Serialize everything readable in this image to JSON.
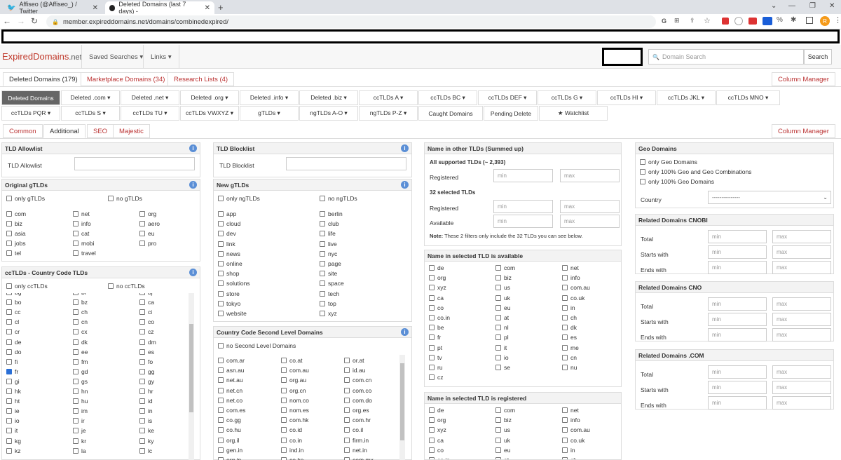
{
  "browser": {
    "tabs": [
      {
        "label": "Affiseo (@Affiseo_) / Twitter"
      },
      {
        "label": "Deleted Domains (last 7 days) -"
      }
    ],
    "new_tab": "+",
    "url": "member.expireddomains.net/domains/combinedexpired/",
    "profile": "R"
  },
  "site": {
    "logo_main": "ExpiredDomains",
    "logo_tld": ".net",
    "nav": [
      "Saved Searches ▾",
      "Links ▾"
    ],
    "search_placeholder": "Domain Search",
    "search_button": "Search"
  },
  "tabs_row1": {
    "items": [
      "Deleted Domains (179)",
      "Marketplace Domains (34)",
      "Research Lists (4)"
    ],
    "column_manager": "Column Manager"
  },
  "nav_row1": [
    "Deleted Domains",
    "Deleted .com ▾",
    "Deleted .net ▾",
    "Deleted .org ▾",
    "Deleted .info ▾",
    "Deleted .biz ▾",
    "ccTLDs A ▾",
    "ccTLDs BC ▾",
    "ccTLDs DEF ▾",
    "ccTLDs G ▾",
    "ccTLDs HI ▾",
    "ccTLDs JKL ▾",
    "ccTLDs MNO ▾"
  ],
  "nav_row2": [
    "ccTLDs PQR ▾",
    "ccTLDs S ▾",
    "ccTLDs TU ▾",
    "ccTLDs VWXYZ ▾",
    "gTLDs ▾",
    "ngTLDs A-O ▾",
    "ngTLDs P-Z ▾",
    "Caught Domains",
    "Pending Delete",
    "★ Watchlist"
  ],
  "filter_tabs": {
    "items": [
      "Common",
      "Additional",
      "SEO",
      "Majestic"
    ],
    "column_manager": "Column Manager"
  },
  "tld_allow": {
    "title": "TLD Allowlist",
    "label": "TLD Allowlist"
  },
  "tld_block": {
    "title": "TLD Blocklist",
    "label": "TLD Blocklist"
  },
  "orig_gtlds": {
    "title": "Original gTLDs",
    "only": "only gTLDs",
    "no": "no gTLDs",
    "items": [
      "com",
      "net",
      "org",
      "biz",
      "info",
      "aero",
      "asia",
      "cat",
      "eu",
      "jobs",
      "mobi",
      "pro",
      "tel",
      "travel"
    ]
  },
  "new_gtlds": {
    "title": "New gTLDs",
    "only": "only ngTLDs",
    "no": "no ngTLDs",
    "items": [
      "app",
      "berlin",
      "cloud",
      "club",
      "dev",
      "life",
      "link",
      "live",
      "news",
      "nyc",
      "online",
      "page",
      "shop",
      "site",
      "solutions",
      "space",
      "store",
      "tech",
      "tokyo",
      "top",
      "website",
      "xyz"
    ]
  },
  "cctlds": {
    "title": "ccTLDs - Country Code TLDs",
    "only": "only ccTLDs",
    "no": "no ccTLDs",
    "items": [
      "bg",
      "bi",
      "bj",
      "bo",
      "bz",
      "ca",
      "cc",
      "ch",
      "ci",
      "cl",
      "cn",
      "co",
      "cr",
      "cx",
      "cz",
      "de",
      "dk",
      "dm",
      "do",
      "ee",
      "es",
      "fi",
      "fm",
      "fo",
      "fr",
      "gd",
      "gg",
      "gi",
      "gs",
      "gy",
      "hk",
      "hn",
      "hr",
      "ht",
      "hu",
      "id",
      "ie",
      "im",
      "in",
      "io",
      "ir",
      "is",
      "it",
      "je",
      "ke",
      "kg",
      "kr",
      "ky",
      "kz",
      "la",
      "lc"
    ]
  },
  "ccsld": {
    "title": "Country Code Second Level Domains",
    "no": "no Second Level Domains",
    "items": [
      "com.ar",
      "co.at",
      "or.at",
      "asn.au",
      "com.au",
      "id.au",
      "net.au",
      "org.au",
      "com.cn",
      "net.cn",
      "org.cn",
      "com.co",
      "net.co",
      "nom.co",
      "com.do",
      "com.es",
      "nom.es",
      "org.es",
      "co.gg",
      "com.hk",
      "com.hr",
      "co.hu",
      "co.id",
      "co.il",
      "org.il",
      "co.in",
      "firm.in",
      "gen.in",
      "ind.in",
      "net.in",
      "org.in",
      "co.ke",
      "com.mx"
    ]
  },
  "other_tlds": {
    "title": "Name in other TLDs (Summed up)",
    "all_label": "All supported TLDs (~ 2,393)",
    "registered": "Registered",
    "selected_label": "32 selected TLDs",
    "available": "Available",
    "min": "min",
    "max": "max",
    "note_bold": "Note:",
    "note": "These 2 filters only include the 32 TLDs you can see below."
  },
  "sel_avail": {
    "title": "Name in selected TLD is available",
    "items": [
      "de",
      "com",
      "net",
      "org",
      "biz",
      "info",
      "xyz",
      "us",
      "com.au",
      "ca",
      "uk",
      "co.uk",
      "co",
      "eu",
      "in",
      "co.in",
      "at",
      "ch",
      "be",
      "nl",
      "dk",
      "fr",
      "pl",
      "es",
      "pt",
      "it",
      "me",
      "tv",
      "io",
      "cn",
      "ru",
      "se",
      "nu",
      "cz"
    ]
  },
  "sel_reg": {
    "title": "Name in selected TLD is registered",
    "items": [
      "de",
      "com",
      "net",
      "org",
      "biz",
      "info",
      "xyz",
      "us",
      "com.au",
      "ca",
      "uk",
      "co.uk",
      "co",
      "eu",
      "in",
      "co.in",
      "at",
      "ch"
    ]
  },
  "geo": {
    "title": "Geo Domains",
    "items": [
      "only Geo Domains",
      "only 100% Geo and Geo Combinations",
      "only 100% Geo Domains"
    ],
    "country_label": "Country",
    "country_value": "---------------"
  },
  "related": [
    {
      "title": "Related Domains CNOBI"
    },
    {
      "title": "Related Domains CNO"
    },
    {
      "title": "Related Domains .COM"
    }
  ],
  "related_rows": [
    "Total",
    "Starts with",
    "Ends with"
  ]
}
